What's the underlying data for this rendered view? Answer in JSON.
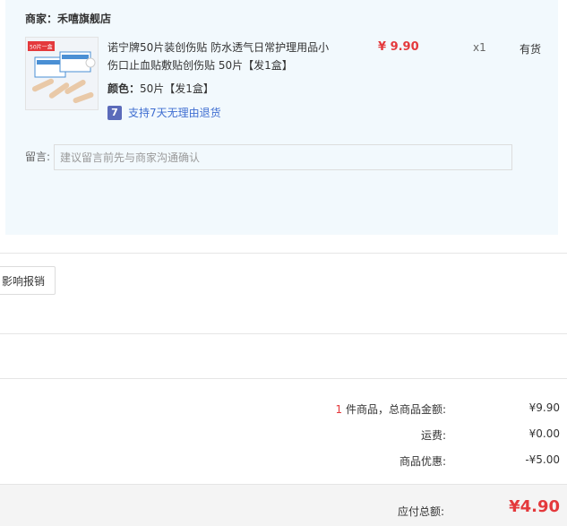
{
  "merchant": {
    "label": "商家：",
    "name": "禾嘻旗舰店"
  },
  "product": {
    "thumb_tag": "50片一盒",
    "title": "诺宁牌50片装创伤贴 防水透气日常护理用品小伤口止血贴敷贴创伤贴 50片【发1盒】",
    "price": "¥ 9.90",
    "quantity": "x1",
    "stock": "有货",
    "spec_label": "颜色：",
    "spec_value": "50片【发1盒】",
    "return_badge": "7",
    "return_text": "支持7天无理由退货"
  },
  "note": {
    "label": "留言:",
    "placeholder": "建议留言前先与商家沟通确认"
  },
  "invoice": {
    "button_label": "影响报销"
  },
  "summary": {
    "item_count": "1",
    "item_count_suffix": " 件商品，总商品金额:",
    "goods_amount": "¥9.90",
    "shipping_label": "运费:",
    "shipping_amount": "¥0.00",
    "discount_label": "商品优惠:",
    "discount_amount": "-¥5.00",
    "total_label": "应付总额:",
    "total_amount": "¥4.90"
  },
  "colors": {
    "accent": "#e4393c",
    "panel": "#f2f9fd",
    "link": "#3f6ed1"
  }
}
